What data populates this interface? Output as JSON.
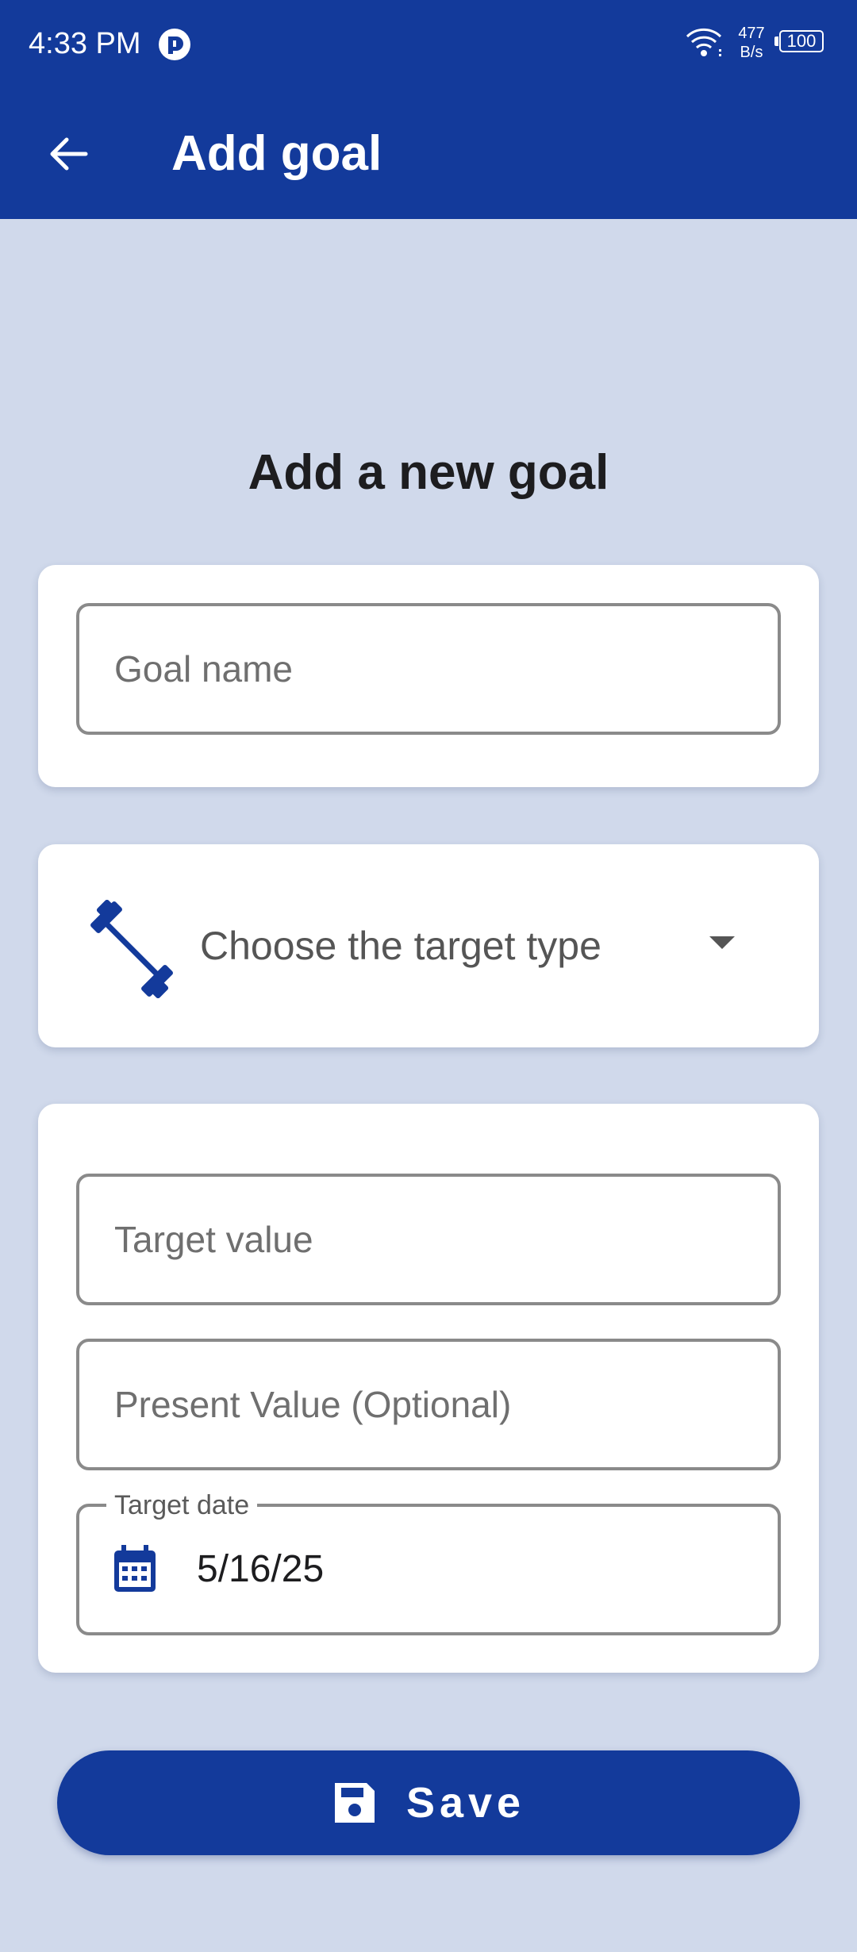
{
  "status_bar": {
    "time": "4:33 PM",
    "network_speed_value": "477",
    "network_speed_unit": "B/s",
    "battery": "100",
    "icons": [
      "app-notification-icon",
      "wifi-icon",
      "battery-icon"
    ]
  },
  "app_bar": {
    "title": "Add goal",
    "back_icon": "arrow-back-icon"
  },
  "heading": "Add a new goal",
  "form": {
    "goal_name": {
      "placeholder": "Goal name",
      "value": ""
    },
    "target_type": {
      "placeholder": "Choose the target type",
      "icon": "barbell-icon"
    },
    "target_value": {
      "placeholder": "Target value",
      "value": ""
    },
    "present_value": {
      "placeholder": "Present Value (Optional)",
      "value": ""
    },
    "target_date": {
      "label": "Target date",
      "value": "5/16/25",
      "icon": "calendar-icon"
    }
  },
  "save_button": {
    "label": "Save",
    "icon": "save-icon"
  },
  "colors": {
    "primary": "#133a9b",
    "background": "#d0d9eb",
    "card": "#ffffff",
    "field_border": "#8a8a8a"
  }
}
